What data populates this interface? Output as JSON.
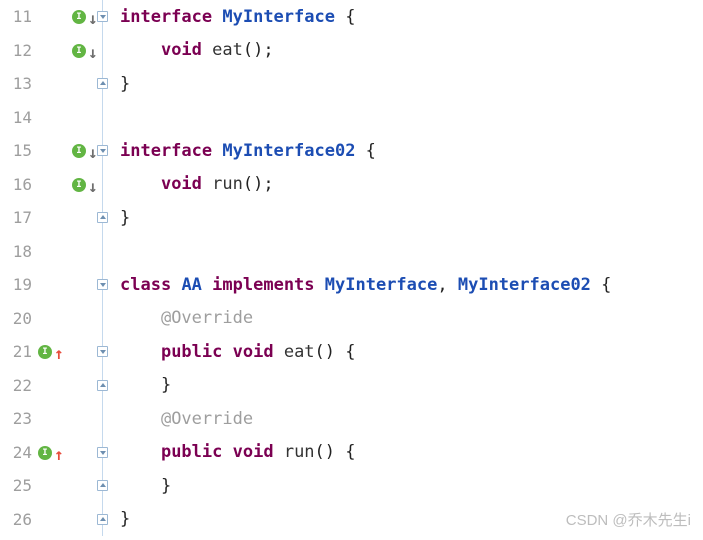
{
  "lines": {
    "l11": {
      "num": "11",
      "kw": "interface",
      "type": "MyInterface",
      "brace": " {"
    },
    "l12": {
      "num": "12",
      "kw": "void",
      "method": "eat",
      "call": "();"
    },
    "l13": {
      "num": "13",
      "brace": "}"
    },
    "l14": {
      "num": "14"
    },
    "l15": {
      "num": "15",
      "kw": "interface",
      "type": "MyInterface02",
      "brace": " {"
    },
    "l16": {
      "num": "16",
      "kw": "void",
      "method": "run",
      "call": "();"
    },
    "l17": {
      "num": "17",
      "brace": "}"
    },
    "l18": {
      "num": "18"
    },
    "l19": {
      "num": "19",
      "kw1": "class",
      "type1": "AA",
      "kw2": "implements",
      "type2": "MyInterface",
      "sep": ", ",
      "type3": "MyInterface02",
      "brace": " {"
    },
    "l20": {
      "num": "20",
      "anno": "@Override"
    },
    "l21": {
      "num": "21",
      "kw1": "public",
      "kw2": "void",
      "method": "eat",
      "call": "() {"
    },
    "l22": {
      "num": "22",
      "brace": "}"
    },
    "l23": {
      "num": "23",
      "anno": "@Override"
    },
    "l24": {
      "num": "24",
      "kw1": "public",
      "kw2": "void",
      "method": "run",
      "call": "() {"
    },
    "l25": {
      "num": "25",
      "brace": "}"
    },
    "l26": {
      "num": "26",
      "brace": "}"
    }
  },
  "iconLabel": "I",
  "arrowDown": "↓",
  "arrowUp": "↑",
  "watermark": "CSDN @乔木先生i"
}
